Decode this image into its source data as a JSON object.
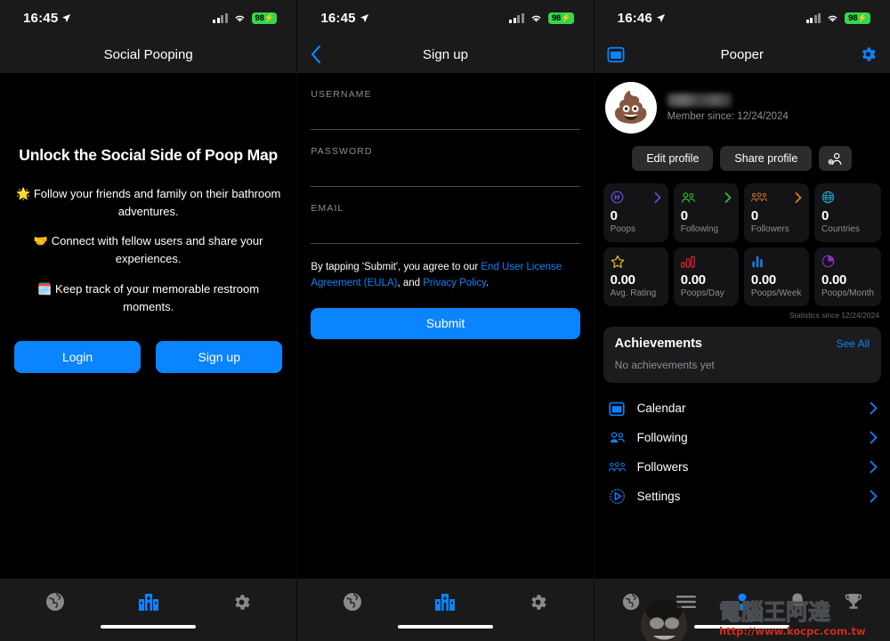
{
  "screens": {
    "welcome": {
      "status": {
        "time": "16:45",
        "battery": "98"
      },
      "nav_title": "Social Pooping",
      "heading": "Unlock the Social Side of Poop Map",
      "features": [
        {
          "emoji": "🌟",
          "text": "Follow your friends and family on their bathroom adventures."
        },
        {
          "emoji": "🤝",
          "text": "Connect with fellow users and share your experiences."
        },
        {
          "emoji": "🗓️",
          "text": "Keep track of your memorable restroom moments."
        }
      ],
      "login_label": "Login",
      "signup_label": "Sign up",
      "tabs": [
        {
          "name": "globe-icon",
          "active": false
        },
        {
          "name": "map-icon",
          "active": true
        },
        {
          "name": "gear-icon",
          "active": false
        }
      ]
    },
    "signup": {
      "status": {
        "time": "16:45",
        "battery": "98"
      },
      "nav_title": "Sign up",
      "back_label": "‹",
      "fields": [
        {
          "label": "USERNAME",
          "value": "",
          "placeholder": ""
        },
        {
          "label": "PASSWORD",
          "value": "",
          "placeholder": ""
        },
        {
          "label": "EMAIL",
          "value": "",
          "placeholder": ""
        }
      ],
      "terms_prefix": "By tapping 'Submit', you agree to our ",
      "terms_link1": "End User License Agreement (EULA)",
      "terms_middle": ", and ",
      "terms_link2": "Privacy Policy",
      "terms_suffix": ".",
      "submit_label": "Submit",
      "tabs": [
        {
          "name": "globe-icon",
          "active": false
        },
        {
          "name": "map-icon",
          "active": true
        },
        {
          "name": "gear-icon",
          "active": false
        }
      ]
    },
    "profile": {
      "status": {
        "time": "16:46",
        "battery": "98"
      },
      "nav_title": "Pooper",
      "avatar_emoji": "💩",
      "username": "",
      "member_since": "Member since: 12/24/2024",
      "edit_label": "Edit profile",
      "share_label": "Share profile",
      "stats": [
        {
          "icon": "hash-circle-icon",
          "glyph": "⑨",
          "color": "#6050dc",
          "value": "0",
          "label": "Poops",
          "chevron": true,
          "chevron_color": "#6050dc"
        },
        {
          "icon": "people-icon",
          "glyph": "👥",
          "color": "#30c030",
          "value": "0",
          "label": "Following",
          "chevron": true,
          "chevron_color": "#30c030"
        },
        {
          "icon": "group-icon",
          "glyph": "👪",
          "color": "#e08020",
          "value": "0",
          "label": "Followers",
          "chevron": true,
          "chevron_color": "#e08020"
        },
        {
          "icon": "globe-icon",
          "glyph": "🌐",
          "color": "#20a0c8",
          "value": "0",
          "label": "Countries",
          "chevron": false,
          "chevron_color": ""
        },
        {
          "icon": "star-icon",
          "glyph": "☆",
          "color": "#e8c020",
          "value": "0.00",
          "label": "Avg. Rating",
          "chevron": false,
          "chevron_color": ""
        },
        {
          "icon": "bar-chart-red-icon",
          "glyph": "█",
          "color": "#e02030",
          "value": "0.00",
          "label": "Poops/Day",
          "chevron": false,
          "chevron_color": ""
        },
        {
          "icon": "bar-chart-blue-icon",
          "glyph": "█",
          "color": "#1a7ad8",
          "value": "0.00",
          "label": "Poops/Week",
          "chevron": false,
          "chevron_color": ""
        },
        {
          "icon": "pie-chart-icon",
          "glyph": "◔",
          "color": "#9030c8",
          "value": "0.00",
          "label": "Poops/Month",
          "chevron": false,
          "chevron_color": ""
        }
      ],
      "stats_since": "Statistics since 12/24/2024",
      "achievements_title": "Achievements",
      "achievements_see_all": "See All",
      "achievements_empty": "No achievements yet",
      "menu": [
        {
          "icon": "calendar-icon",
          "label": "Calendar"
        },
        {
          "icon": "following-icon",
          "label": "Following"
        },
        {
          "icon": "followers-icon",
          "label": "Followers"
        },
        {
          "icon": "settings-icon",
          "label": "Settings"
        }
      ],
      "tabs": [
        {
          "name": "globe-icon",
          "active": false
        },
        {
          "name": "menu-icon",
          "active": false
        },
        {
          "name": "person-icon",
          "active": true
        },
        {
          "name": "bell-icon",
          "active": false
        },
        {
          "name": "trophy-icon",
          "active": false
        }
      ]
    }
  },
  "watermark": {
    "text": "電腦王阿達",
    "url": "http://www.kocpc.com.tw"
  },
  "colors": {
    "accent": "#0a84ff",
    "battery": "#32d74b",
    "card": "#1c1c1e",
    "statcard": "#141416"
  }
}
